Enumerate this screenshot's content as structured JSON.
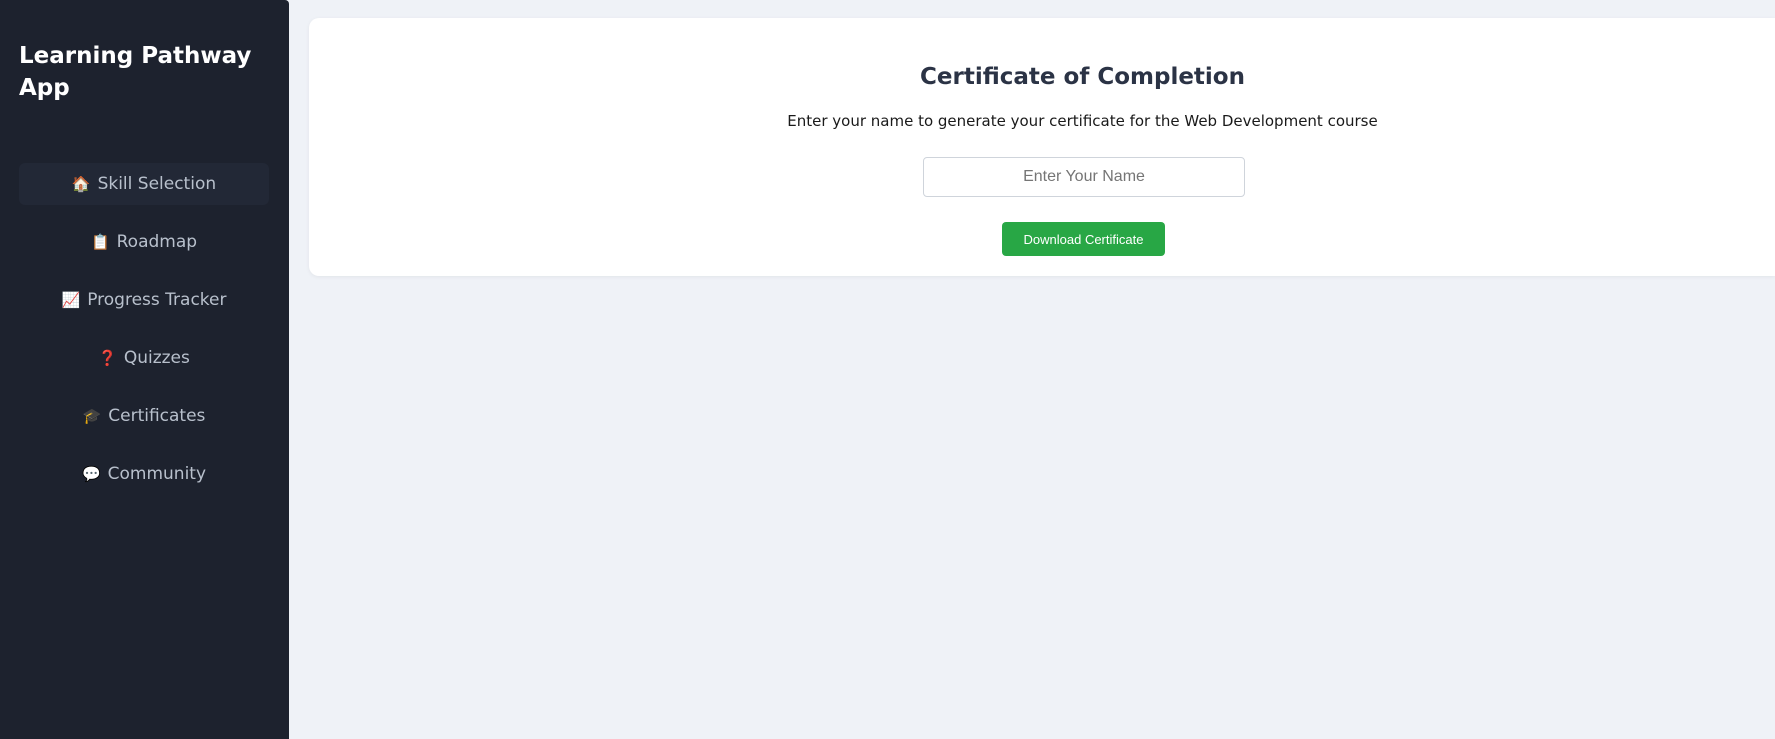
{
  "app": {
    "title": "Learning Pathway App"
  },
  "sidebar": {
    "items": [
      {
        "icon": "🏠",
        "icon_name": "house-icon",
        "label": "Skill Selection",
        "active": true
      },
      {
        "icon": "📋",
        "icon_name": "clipboard-icon",
        "label": "Roadmap",
        "active": false
      },
      {
        "icon": "📈",
        "icon_name": "chart-increasing-icon",
        "label": "Progress Tracker",
        "active": false
      },
      {
        "icon": "❓",
        "icon_name": "question-mark-icon",
        "label": "Quizzes",
        "active": false
      },
      {
        "icon": "🎓",
        "icon_name": "graduation-cap-icon",
        "label": "Certificates",
        "active": false
      },
      {
        "icon": "💬",
        "icon_name": "speech-bubble-icon",
        "label": "Community",
        "active": false
      }
    ]
  },
  "certificate": {
    "title": "Certificate of Completion",
    "description": "Enter your name to generate your certificate for the Web Development course",
    "name_input": {
      "value": "",
      "placeholder": "Enter Your Name"
    },
    "download_label": "Download Certificate"
  },
  "colors": {
    "sidebar_bg": "#1d222e",
    "page_bg": "#eff2f7",
    "button_green": "#28a745",
    "title_color": "#2b3345"
  }
}
